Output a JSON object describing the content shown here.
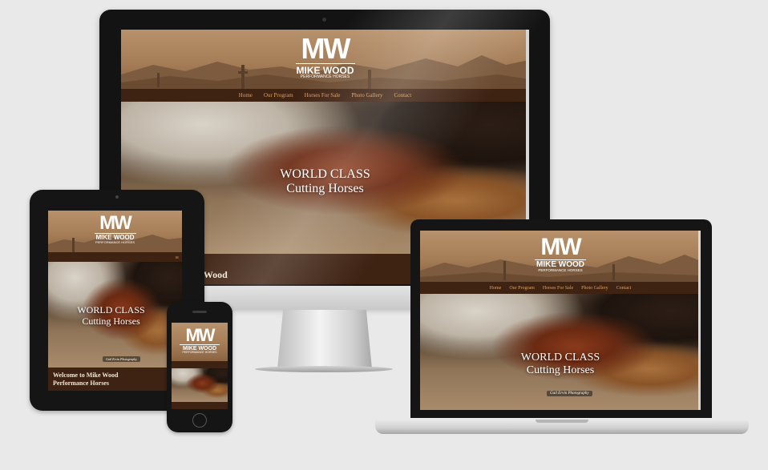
{
  "site": {
    "logo_mark": "MW",
    "logo_name": "MIKE WOOD",
    "logo_sub": "PERFORMANCE HORSES",
    "nav": [
      "Home",
      "Our Program",
      "Horses For Sale",
      "Photo Gallery",
      "Contact"
    ],
    "hero_line1": "WORLD CLASS",
    "hero_line2": "Cutting Horses",
    "welcome_partial": "ke Wood",
    "welcome_line1": "Welcome to Mike Wood",
    "welcome_line2": "Performance Horses",
    "photo_credit": "Gail Ervin Photography",
    "menu_icon": "≡"
  },
  "colors": {
    "background": "#e9e9e9",
    "header_tan": "#a57d57",
    "nav_brown": "#3e2212",
    "nav_link": "#d9a06a",
    "device_black": "#131313"
  },
  "icons": {
    "menu": "hamburger-menu-icon"
  }
}
